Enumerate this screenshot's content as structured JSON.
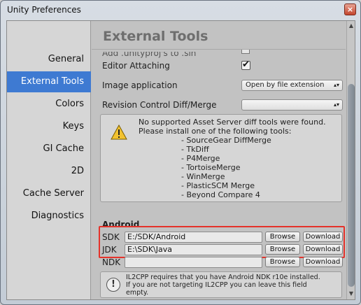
{
  "window": {
    "title": "Unity Preferences",
    "close_glyph": "×"
  },
  "sidebar": {
    "items": [
      {
        "label": "General",
        "active": false
      },
      {
        "label": "External Tools",
        "active": true
      },
      {
        "label": "Colors",
        "active": false
      },
      {
        "label": "Keys",
        "active": false
      },
      {
        "label": "GI Cache",
        "active": false
      },
      {
        "label": "2D",
        "active": false
      },
      {
        "label": "Cache Server",
        "active": false
      },
      {
        "label": "Diagnostics",
        "active": false
      }
    ]
  },
  "main": {
    "title": "External Tools",
    "cut_off_label": "Add .unityproj's to .sln",
    "editor_attaching": {
      "label": "Editor Attaching",
      "checked": true,
      "check_glyph": "✔"
    },
    "image_application": {
      "label": "Image application",
      "value": "Open by file extension",
      "arrows": "▴▾"
    },
    "revision_control": {
      "label": "Revision Control Diff/Merge",
      "value": "",
      "arrows": "▴▾"
    },
    "diff_warning": {
      "icon": "warning-icon",
      "lines": [
        "No supported Asset Server diff tools were found.",
        "Please install one of the following tools:"
      ],
      "tools": [
        "- SourceGear DiffMerge",
        "- TkDiff",
        "- P4Merge",
        "- TortoiseMerge",
        "- WinMerge",
        "- PlasticSCM Merge",
        "- Beyond Compare 4"
      ]
    },
    "android": {
      "section_label": "Android",
      "sdk": {
        "label": "SDK",
        "value": "E:/SDK/Android"
      },
      "jdk": {
        "label": "JDK",
        "value": "E:\\SDK\\Java"
      },
      "ndk": {
        "label": "NDK",
        "value": ""
      },
      "browse_label": "Browse",
      "download_label": "Download"
    },
    "il2cpp_info": {
      "icon_glyph": "!",
      "lines": [
        "IL2CPP requires that you have Android NDK r10e installed.",
        "If you are not targeting IL2CPP you can leave this field",
        "empty."
      ]
    }
  },
  "scrollbar": {
    "up_glyph": "▲",
    "down_glyph": "▼"
  },
  "colors": {
    "accent": "#3e7ad2",
    "highlight": "#e5322a"
  }
}
